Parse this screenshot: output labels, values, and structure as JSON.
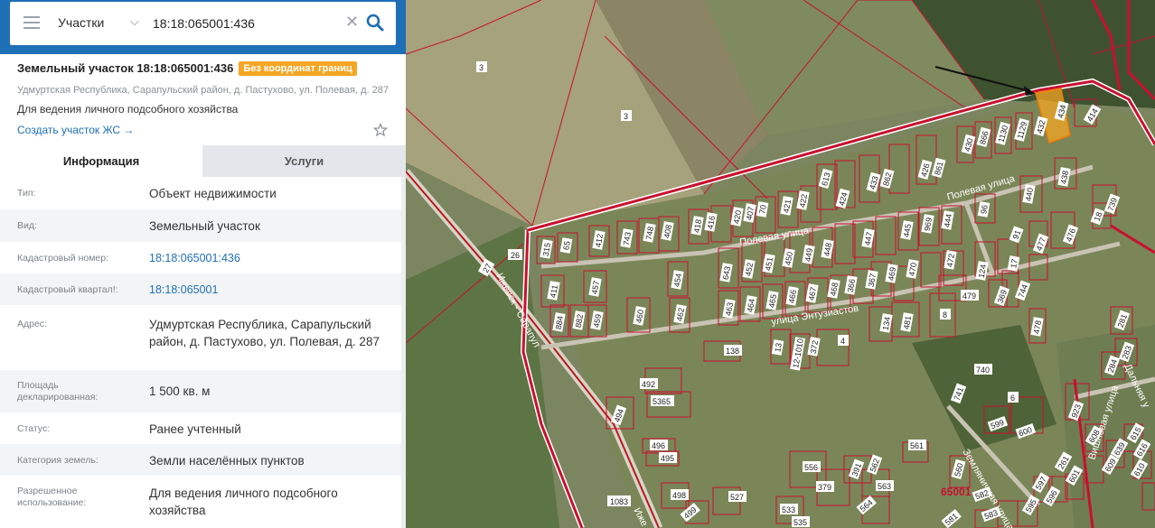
{
  "search": {
    "category": "Участки",
    "query": "18:18:065001:436"
  },
  "card": {
    "title": "Земельный участок 18:18:065001:436",
    "badge": "Без координат границ",
    "address": "Удмуртская Республика, Сарапульский район, д. Пастухово, ул. Полевая, д. 287",
    "purpose": "Для ведения личного подсобного хозяйства",
    "create_link": "Создать участок ЖС →"
  },
  "tabs": {
    "info": "Информация",
    "services": "Услуги"
  },
  "rows": [
    {
      "label": "Тип:",
      "value": "Объект недвижимости"
    },
    {
      "label": "Вид:",
      "value": "Земельный участок"
    },
    {
      "label": "Кадастровый номер:",
      "value": "18:18:065001:436"
    },
    {
      "label": "Кадастровый квартал!:",
      "value": "18:18:065001"
    },
    {
      "label": "Адрес:",
      "value": "Удмуртская Республика, Сарапульский район, д. Пастухово, ул. Полевая, д. 287"
    },
    {
      "label": "Площадь декларированная:",
      "value": "1 500 кв. м"
    },
    {
      "label": "Статус:",
      "value": "Ранее учтенный"
    },
    {
      "label": "Категория земель:",
      "value": "Земли населённых пунктов"
    },
    {
      "label": "Разрешенное использование:",
      "value": "Для ведения личного подсобного хозяйства"
    }
  ],
  "map": {
    "roads": {
      "main": "Ижевск - Сарапул",
      "main_bottom": "Иже",
      "polevaya_1": "Полевая улица",
      "polevaya_2": "Полевая улица",
      "entuziastov": "улица Энтузиастов",
      "zemlyanich": "Земляничная улица",
      "vishnev": "Вишнёвая улица",
      "dalnyaya": "Дальняя у"
    },
    "quarter": "65001",
    "parcels": {
      "p3a": "3",
      "p3b": "3",
      "p26": "26",
      "p27": "27",
      "p1083": "1083",
      "p315": "315",
      "p65": "65",
      "p412": "412",
      "p743": "743",
      "p748": "748",
      "p408": "408",
      "p418": "418",
      "p416": "416",
      "p420": "420",
      "p407": "407",
      "p70": "70",
      "p421": "421",
      "p422": "422",
      "p613": "613",
      "p424": "424",
      "p433": "433",
      "p862": "862",
      "p426": "426",
      "p861": "861",
      "p430": "430",
      "p866": "866",
      "p1130": "1130",
      "p1129": "1129",
      "p432": "432",
      "p434": "434",
      "p414": "414",
      "p440": "440",
      "p438": "438",
      "p739": "739",
      "p18": "18",
      "p476": "476",
      "p477": "477",
      "p91": "91",
      "p96": "96",
      "p445": "445",
      "p969": "969",
      "p444": "444",
      "p447": "447",
      "p448": "448",
      "p449": "449",
      "p450": "450",
      "p451": "451",
      "p452": "452",
      "p643": "643",
      "p411": "411",
      "p457": "457",
      "p884": "884",
      "p882": "882",
      "p459": "459",
      "p460": "460",
      "p454": "454",
      "p462": "462",
      "p463": "463",
      "p464": "464",
      "p465": "465",
      "p466": "466",
      "p467": "467",
      "p468": "468",
      "p366": "366",
      "p367": "367",
      "p469": "469",
      "p470": "470",
      "p472": "472",
      "p124": "124",
      "p17": "17",
      "p479": "479",
      "p369": "369",
      "p744": "744",
      "p478": "478",
      "p8": "8",
      "p481": "481",
      "p134": "134",
      "p138": "138",
      "p13": "13",
      "p1010": "12-1010",
      "p372": "372",
      "p4": "4",
      "p740": "740",
      "p741": "741",
      "p6": "6",
      "p599": "599",
      "p600": "600",
      "p923": "923",
      "p281": "281",
      "p283": "283",
      "p284": "284",
      "p492": "492",
      "p5365": "5365",
      "p494": "494",
      "p496": "496",
      "p495": "495",
      "p498": "498",
      "p499": "499",
      "p527": "527",
      "p556": "556",
      "p379": "379",
      "p391": "391",
      "p562": "562",
      "p563": "563",
      "p564": "564",
      "p561": "561",
      "p533": "533",
      "p535": "535",
      "p560": "560",
      "p581": "581",
      "p582": "582",
      "p583": "583",
      "p595": "595",
      "p596": "596",
      "p597": "597",
      "p261": "261",
      "p601": "601",
      "p608": "608",
      "p609": "609",
      "p639": "639",
      "p615": "615",
      "p616": "616",
      "p610": "610"
    }
  },
  "colors": {
    "accent": "#1e6fb6",
    "badge": "#f5a623",
    "parcel_border": "#d0021b",
    "selected_parcel": "#f5a623"
  }
}
